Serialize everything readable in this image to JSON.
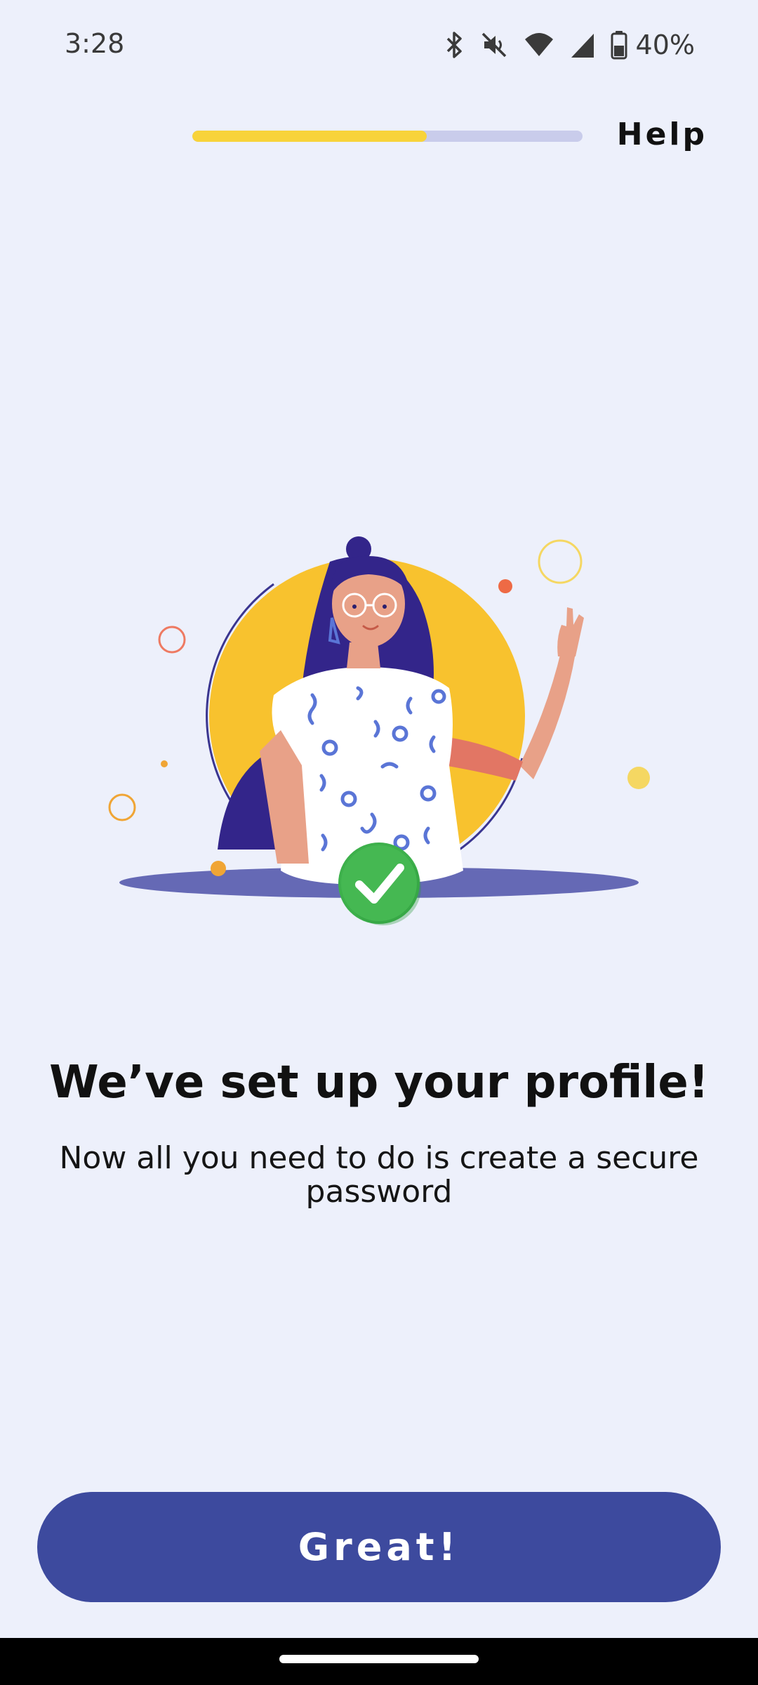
{
  "status_bar": {
    "time": "3:28",
    "battery": "40%",
    "icons": [
      "bluetooth-icon",
      "mute-icon",
      "wifi-icon",
      "signal-icon",
      "battery-icon"
    ]
  },
  "header": {
    "progress_fraction": 0.6,
    "help_label": "Help"
  },
  "hero": {
    "illustration": "woman-waving-with-checkmark"
  },
  "content": {
    "title": "We’ve set up your profile!",
    "subtitle": "Now all you need to do is create a secure password"
  },
  "footer": {
    "button_label": "Great!"
  },
  "colors": {
    "background": "#EDF0FB",
    "accent_yellow": "#F8D33A",
    "primary": "#3D4A9E",
    "success": "#3DB04B"
  }
}
